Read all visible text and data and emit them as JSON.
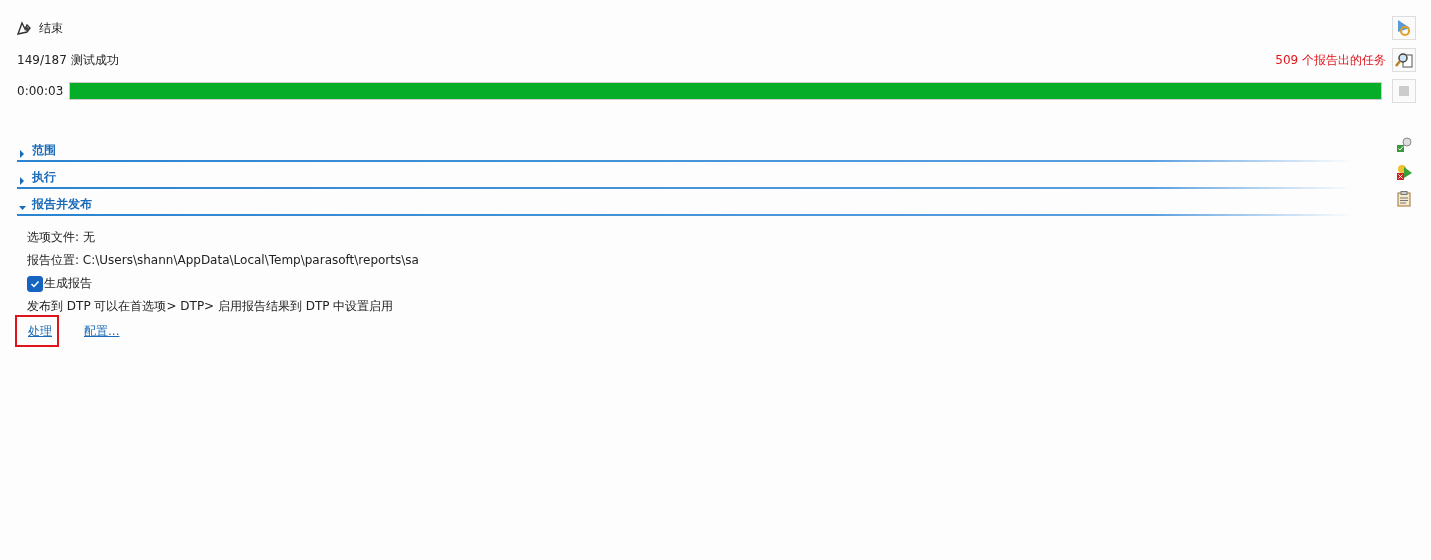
{
  "status": {
    "title": "结束",
    "summary": "149/187 测试成功",
    "tasks": "509 个报告出的任务",
    "elapsed": "0:00:03",
    "progress": {
      "level": 1.0
    },
    "stop_button": {
      "disabled": true
    }
  },
  "sections": [
    {
      "title": "范围",
      "expanded": false
    },
    {
      "title": "执行",
      "expanded": false
    },
    {
      "title": "报告并发布",
      "expanded": true
    }
  ],
  "report": {
    "options_file": "选项文件: 无",
    "location": "报告位置: C:\\Users\\shann\\AppData\\Local\\Temp\\parasoft\\reports\\sa",
    "generate_report": {
      "label": "生成报告",
      "checked": true
    },
    "publish_note": "发布到 DTP 可以在首选项> DTP> 启用报告结果到 DTP 中设置启用",
    "links": [
      {
        "label": "处理",
        "highlighted": true
      },
      {
        "label": "配置...",
        "highlighted": false
      }
    ]
  }
}
